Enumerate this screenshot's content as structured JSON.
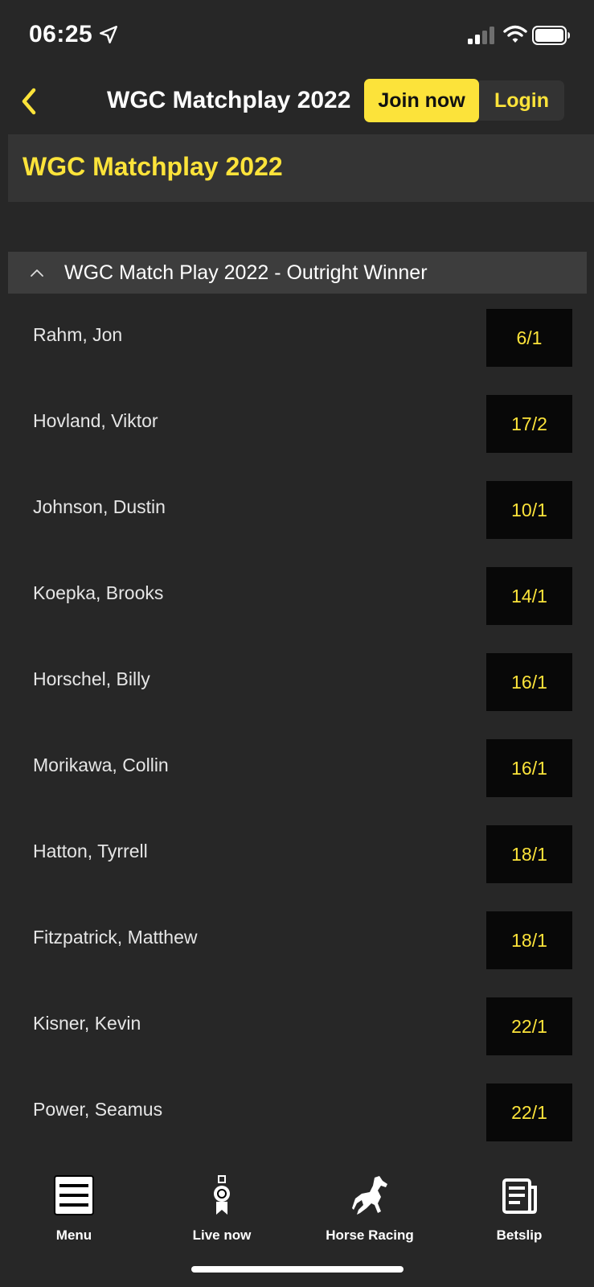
{
  "status_bar": {
    "time": "06:25",
    "icons": [
      "location-arrow-icon",
      "signal-icon",
      "wifi-icon",
      "battery-icon"
    ]
  },
  "header": {
    "back_icon": "chevron-left-icon",
    "title": "WGC Matchplay 2022",
    "join_label": "Join now",
    "login_label": "Login"
  },
  "page": {
    "title": "WGC Matchplay 2022"
  },
  "market": {
    "title": "WGC Match Play 2022 - Outright Winner",
    "collapse_icon": "chevron-up-icon",
    "runners": [
      {
        "name": "Rahm, Jon",
        "odds": "6/1"
      },
      {
        "name": "Hovland, Viktor",
        "odds": "17/2"
      },
      {
        "name": "Johnson, Dustin",
        "odds": "10/1"
      },
      {
        "name": "Koepka, Brooks",
        "odds": "14/1"
      },
      {
        "name": "Horschel, Billy",
        "odds": "16/1"
      },
      {
        "name": "Morikawa, Collin",
        "odds": "16/1"
      },
      {
        "name": "Hatton, Tyrrell",
        "odds": "18/1"
      },
      {
        "name": "Fitzpatrick, Matthew",
        "odds": "18/1"
      },
      {
        "name": "Kisner, Kevin",
        "odds": "22/1"
      },
      {
        "name": "Power, Seamus",
        "odds": "22/1"
      }
    ]
  },
  "bottom_nav": {
    "items": [
      {
        "label": "Menu",
        "icon": "menu-icon"
      },
      {
        "label": "Live now",
        "icon": "stopwatch-icon"
      },
      {
        "label": "Horse Racing",
        "icon": "horse-icon"
      },
      {
        "label": "Betslip",
        "icon": "betslip-icon"
      }
    ]
  },
  "colors": {
    "background": "#272727",
    "accent": "#fce33a",
    "odds_background": "#080808",
    "market_header": "#3d3d3d",
    "banner": "#343434"
  }
}
